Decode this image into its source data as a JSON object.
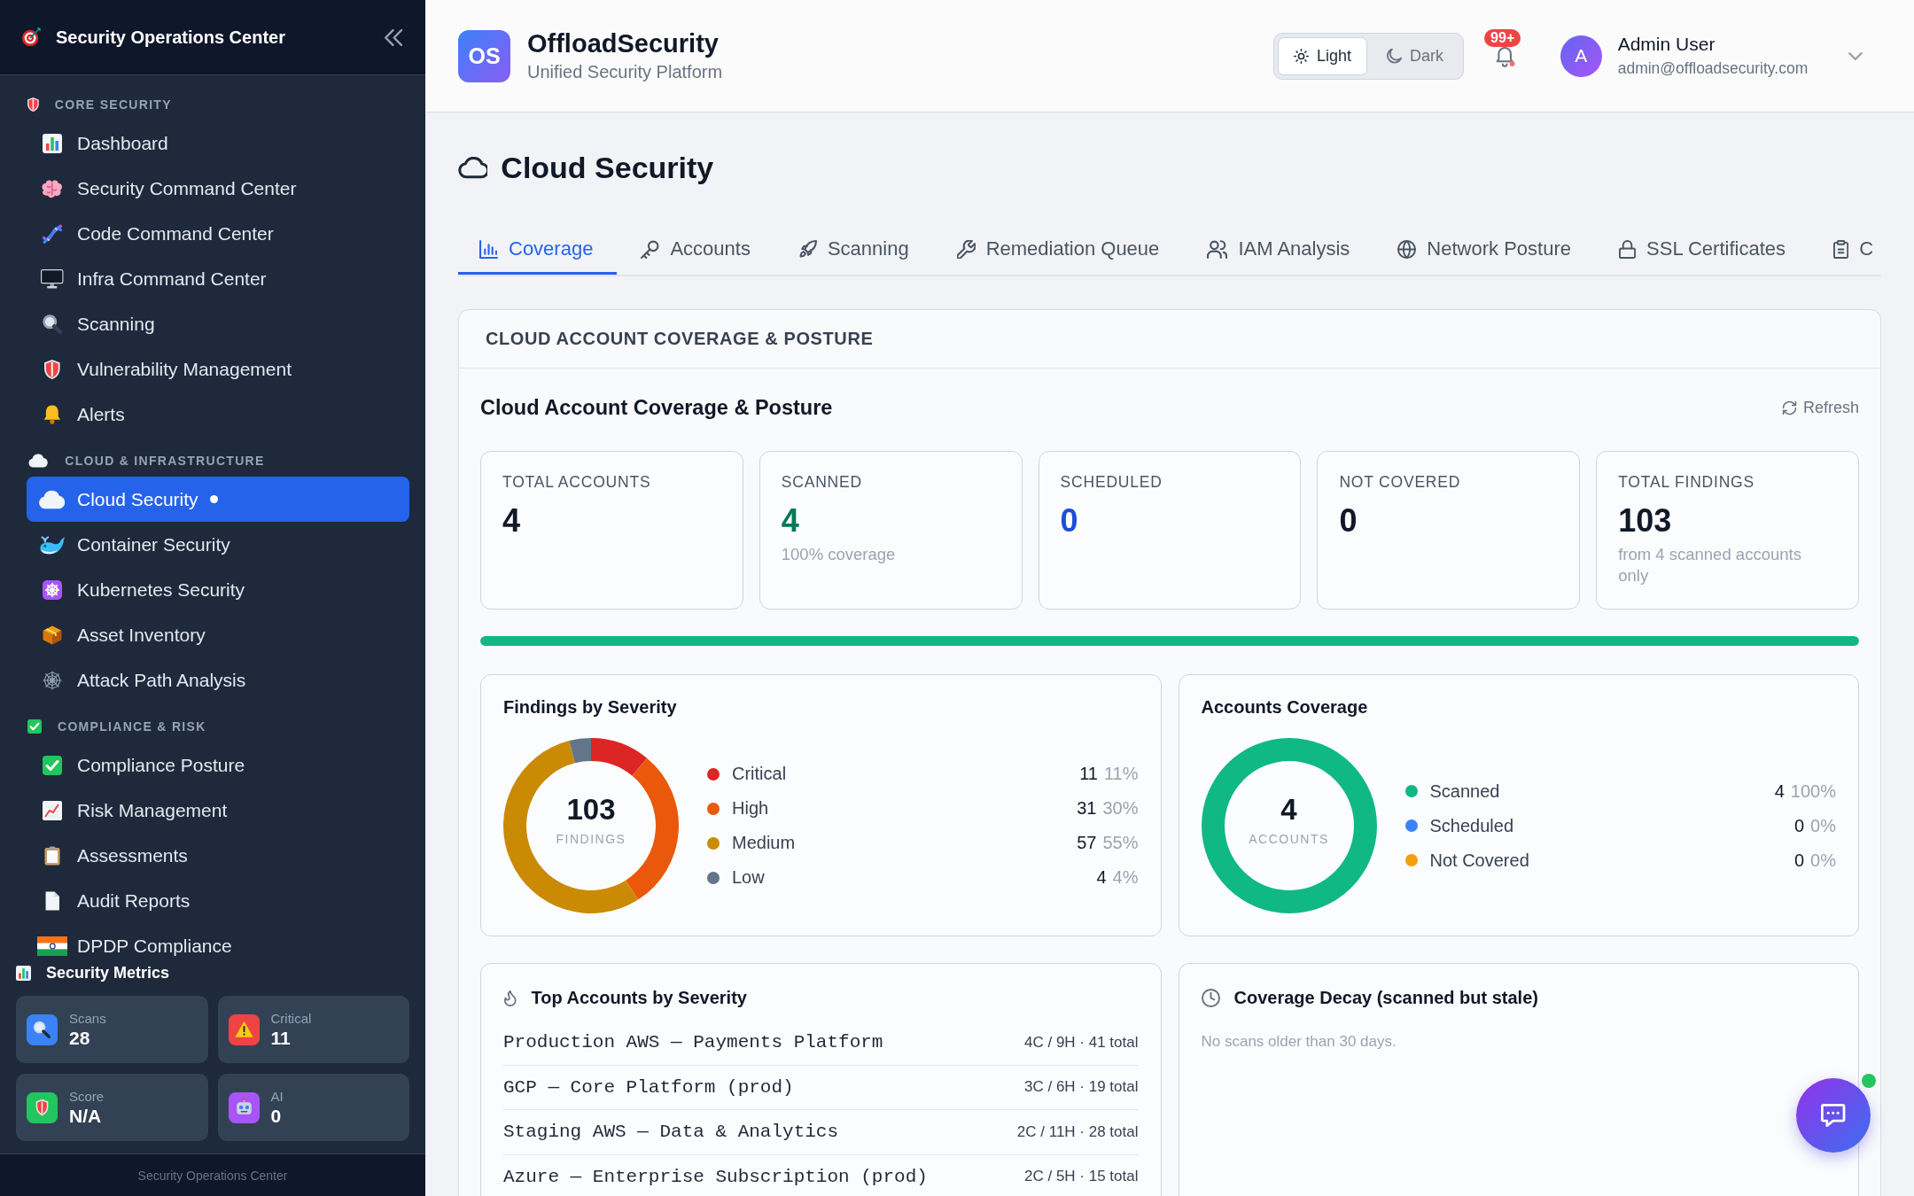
{
  "sidebar": {
    "title": "Security Operations Center",
    "sections": [
      {
        "label": "CORE SECURITY",
        "items": [
          {
            "label": "Dashboard",
            "selected": false
          },
          {
            "label": "Security Command Center",
            "selected": false
          },
          {
            "label": "Code Command Center",
            "selected": false
          },
          {
            "label": "Infra Command Center",
            "selected": false
          },
          {
            "label": "Scanning",
            "selected": false
          },
          {
            "label": "Vulnerability Management",
            "selected": false
          },
          {
            "label": "Alerts",
            "selected": false
          }
        ]
      },
      {
        "label": "CLOUD & INFRASTRUCTURE",
        "items": [
          {
            "label": "Cloud Security",
            "selected": true
          },
          {
            "label": "Container Security",
            "selected": false
          },
          {
            "label": "Kubernetes Security",
            "selected": false
          },
          {
            "label": "Asset Inventory",
            "selected": false
          },
          {
            "label": "Attack Path Analysis",
            "selected": false
          }
        ]
      },
      {
        "label": "COMPLIANCE & RISK",
        "items": [
          {
            "label": "Compliance Posture",
            "selected": false
          },
          {
            "label": "Risk Management",
            "selected": false
          },
          {
            "label": "Assessments",
            "selected": false
          },
          {
            "label": "Audit Reports",
            "selected": false
          },
          {
            "label": "DPDP Compliance",
            "selected": false
          }
        ]
      }
    ],
    "metrics": {
      "title": "Security Metrics",
      "cards": [
        {
          "label": "Scans",
          "value": "28"
        },
        {
          "label": "Critical",
          "value": "11"
        },
        {
          "label": "Score",
          "value": "N/A"
        },
        {
          "label": "AI",
          "value": "0"
        }
      ]
    },
    "footer": "Security Operations Center"
  },
  "header": {
    "logo": "OS",
    "title": "OffloadSecurity",
    "subtitle": "Unified Security Platform",
    "theme": [
      {
        "label": "Light",
        "selected": true
      },
      {
        "label": "Dark",
        "selected": false
      }
    ],
    "notifications": {
      "badge": "99+"
    },
    "user": {
      "avatar": "A",
      "name": "Admin User",
      "email": "admin@offloadsecurity.com"
    }
  },
  "page": {
    "title": "Cloud Security",
    "tabs": [
      {
        "label": "Coverage",
        "selected": true
      },
      {
        "label": "Accounts",
        "selected": false
      },
      {
        "label": "Scanning",
        "selected": false
      },
      {
        "label": "Remediation Queue",
        "selected": false
      },
      {
        "label": "IAM Analysis",
        "selected": false
      },
      {
        "label": "Network Posture",
        "selected": false
      },
      {
        "label": "SSL Certificates",
        "selected": false
      },
      {
        "label": "C",
        "selected": false
      }
    ],
    "panel": {
      "header": "CLOUD ACCOUNT COVERAGE & POSTURE",
      "title": "Cloud Account Coverage & Posture",
      "refresh": "Refresh",
      "stats": [
        {
          "label": "TOTAL ACCOUNTS",
          "value": "4",
          "color": "#111827"
        },
        {
          "label": "SCANNED",
          "value": "4",
          "note": "100% coverage",
          "color": "#047857"
        },
        {
          "label": "SCHEDULED",
          "value": "0",
          "color": "#1d4ed8"
        },
        {
          "label": "NOT COVERED",
          "value": "0",
          "color": "#111827"
        },
        {
          "label": "TOTAL FINDINGS",
          "value": "103",
          "note": "from 4 scanned accounts only",
          "color": "#111827"
        }
      ],
      "coverage_bar": {
        "level": 1
      },
      "findings": {
        "title": "Findings by Severity",
        "center_value": "103",
        "center_label": "FINDINGS",
        "legend": [
          {
            "count": "11",
            "percent": "11%",
            "color": "#dc2626"
          },
          {
            "count": "31",
            "percent": "30%",
            "color": "#ea580c"
          },
          {
            "count": "57",
            "percent": "55%",
            "color": "#ca8a04"
          },
          {
            "count": "4",
            "percent": "4%",
            "color": "#64748b"
          }
        ],
        "chart_data": {
          "type": "donut",
          "categories": [
            "Critical",
            "High",
            "Medium",
            "Low"
          ],
          "values": [
            11,
            30,
            55,
            4
          ]
        }
      },
      "accounts_coverage": {
        "title": "Accounts Coverage",
        "center_value": "4",
        "center_label": "ACCOUNTS",
        "ring": {
          "level": 1
        },
        "legend": [
          {
            "label": "Scanned",
            "count": "4",
            "percent": "100%",
            "color": "#10b981"
          },
          {
            "label": "Scheduled",
            "count": "0",
            "percent": "0%",
            "color": "#3b82f6"
          },
          {
            "label": "Not Covered",
            "count": "0",
            "percent": "0%",
            "color": "#f59e0b"
          }
        ]
      },
      "top_accounts": {
        "title": "Top Accounts by Severity",
        "rows": [
          {
            "name": "Production AWS — Payments Platform",
            "summary": "4C / 9H · 41 total"
          },
          {
            "name": "GCP — Core Platform (prod)",
            "summary": "3C / 6H · 19 total"
          },
          {
            "name": "Staging AWS — Data & Analytics",
            "summary": "2C / 11H · 28 total"
          },
          {
            "name": "Azure — Enterprise Subscription (prod)",
            "summary": "2C / 5H · 15 total"
          }
        ]
      },
      "coverage_decay": {
        "title": "Coverage Decay (scanned but stale)",
        "message": "No scans older than 30 days."
      }
    }
  },
  "chat": {
    "online": true
  }
}
